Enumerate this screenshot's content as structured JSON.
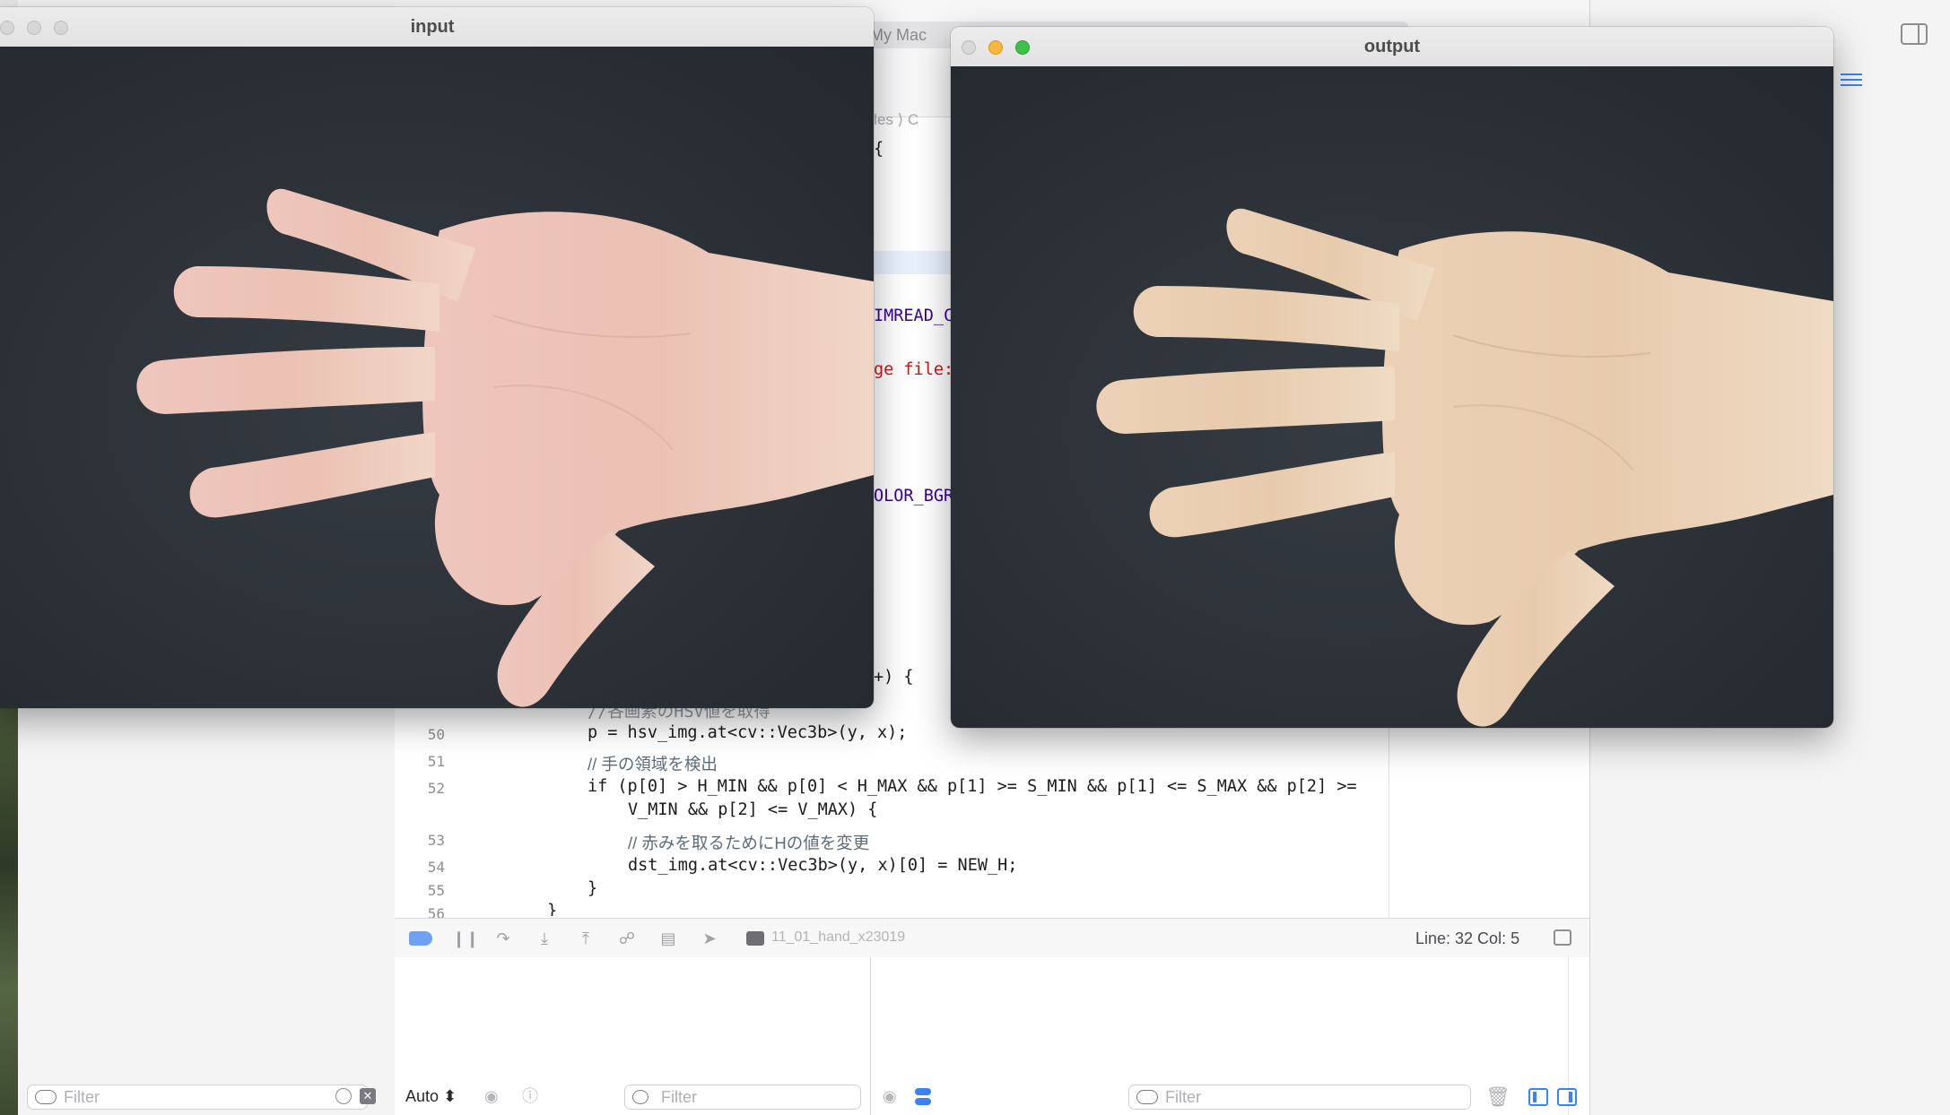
{
  "xcode": {
    "scheme_tab": "My Mac",
    "jump_bar": "Files ⟩  C",
    "line_col": "Line: 32  Col: 5",
    "process_name": "11_01_hand_x23019",
    "auto_select": "Auto ⬍",
    "filters": {
      "navigator": "Filter",
      "variables": "Filter",
      "console": "Filter"
    }
  },
  "code_fragments": {
    "brace": "{",
    "imread": "IMREAD_C",
    "err_msg": "ge file:",
    "cvt": "OLOR_BGR",
    "loop": "+) {"
  },
  "code_lines": [
    {
      "num": "50",
      "text": "p = hsv_img.at<cv::Vec3b>(y, x);"
    },
    {
      "num": "51",
      "text": "// 手の領域を検出"
    },
    {
      "num": "52",
      "text": "if (p[0] > H_MIN && p[0] < H_MAX && p[1] >= S_MIN && p[1] <= S_MAX && p[2] >="
    },
    {
      "num": "",
      "text": "V_MIN && p[2] <= V_MAX) {"
    },
    {
      "num": "53",
      "text": "// 赤みを取るためにHの値を変更"
    },
    {
      "num": "54",
      "text": "dst_img.at<cv::Vec3b>(y, x)[0] = NEW_H;"
    },
    {
      "num": "55",
      "text": "}"
    },
    {
      "num": "56",
      "text": "}"
    }
  ],
  "partial_comment": "//各画素のHSV値を取得",
  "windows": {
    "input": {
      "title": "input"
    },
    "output": {
      "title": "output"
    }
  },
  "colors": {
    "accent": "#3b82f6",
    "background_cloth": "#2b3036",
    "skin_input": "#e9c1b4",
    "skin_output": "#e9cdb0"
  },
  "icons": [
    "sidebar-toggle-icon",
    "adjust-icon",
    "breakpoint-icon",
    "pause-icon",
    "step-over-icon",
    "step-into-icon",
    "step-out-icon",
    "debug-view-hierarchy-icon",
    "environment-icon",
    "location-icon",
    "terminal-icon",
    "console-toggle-icon",
    "filter-icon",
    "clock-icon",
    "clear-icon",
    "eye-icon",
    "info-icon",
    "trash-icon",
    "pane-left-icon",
    "pane-right-icon"
  ]
}
